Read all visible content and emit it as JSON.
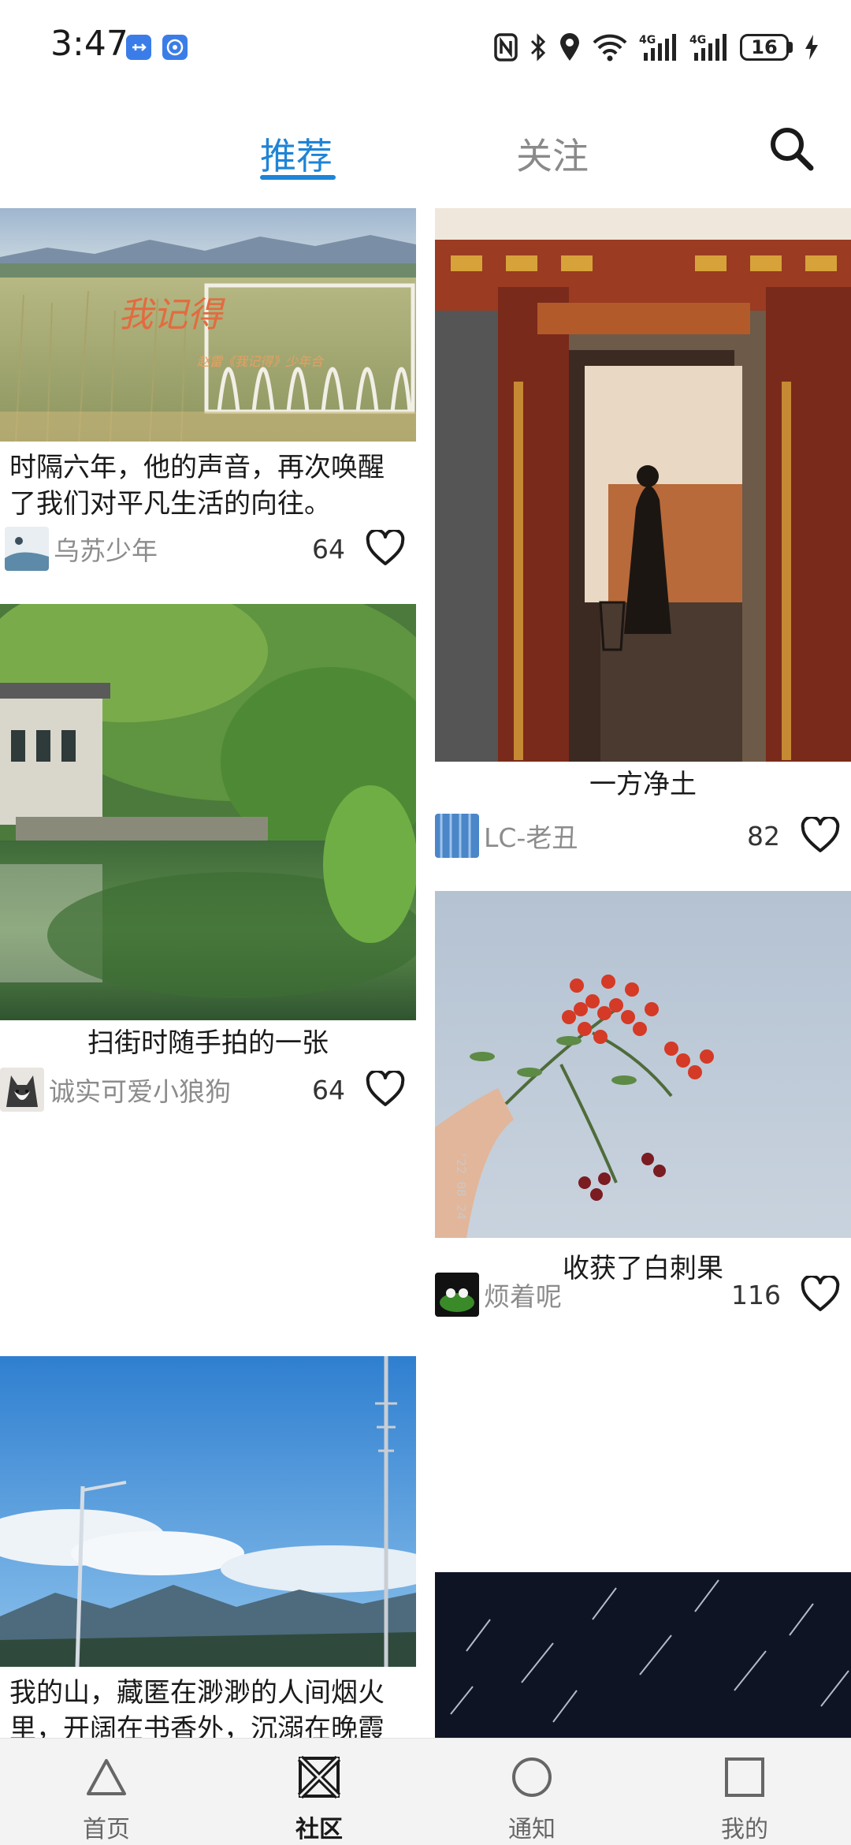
{
  "status_bar": {
    "time": "3:47",
    "battery": "16",
    "icons": [
      "usb-icon",
      "app-notification-icon",
      "nfc-icon",
      "bluetooth-icon",
      "location-icon",
      "wifi-icon",
      "signal-4g-icon",
      "signal-4g-icon",
      "battery-icon",
      "charging-icon"
    ]
  },
  "top_tabs": {
    "recommend": "推荐",
    "follow": "关注",
    "active": "推荐",
    "search_icon": "search-icon"
  },
  "feed": {
    "left": [
      {
        "title": "时隔六年，他的声音，再次唤醒了我们对平凡生活的向往。",
        "image_text": "我记得",
        "image_caption": "赵雷《我记得》少年合",
        "author": "乌苏少年",
        "likes": "64"
      },
      {
        "title": "扫街时随手拍的一张",
        "author": "诚实可爱小狼狗",
        "likes": "64"
      },
      {
        "title": "我的山，藏匿在渺渺的人间烟火里，开阔在书香外，沉溺在晚霞",
        "author": "",
        "likes": ""
      }
    ],
    "right": [
      {
        "title": "一方净土",
        "author": "LC-老丑",
        "likes": "82"
      },
      {
        "title": "收获了白刺果",
        "image_text": "'22 08 24",
        "author": "烦着呢",
        "likes": "116"
      },
      {
        "title": "",
        "author": "",
        "likes": ""
      }
    ]
  },
  "bottom_nav": {
    "items": [
      {
        "label": "首页",
        "icon": "triangle-icon"
      },
      {
        "label": "社区",
        "icon": "community-x-icon"
      },
      {
        "label": "通知",
        "icon": "circle-icon"
      },
      {
        "label": "我的",
        "icon": "square-icon"
      }
    ],
    "active": "社区"
  },
  "colors": {
    "accent": "#1f84d6",
    "inactive_tab": "#8a8a8a",
    "nav_bg": "#f3f3f3"
  }
}
